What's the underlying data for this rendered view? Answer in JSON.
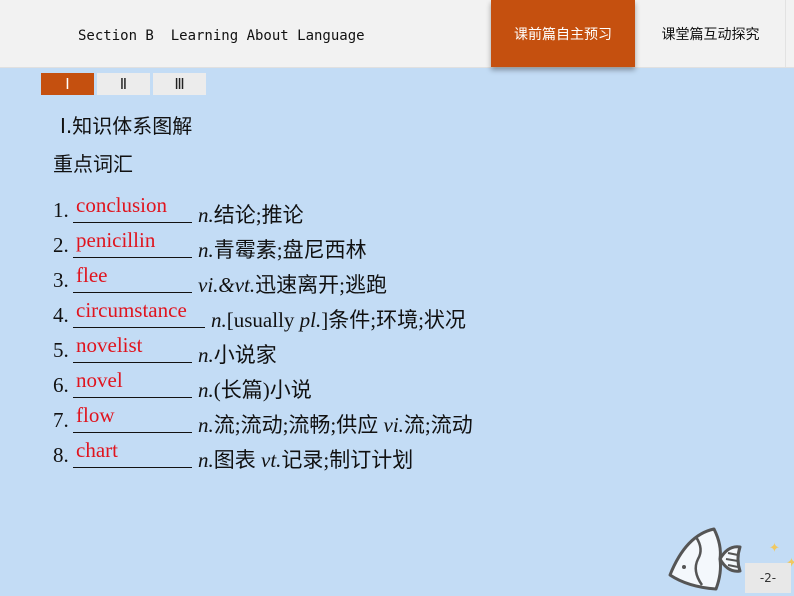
{
  "header": {
    "section_title": "Section B  Learning About Language",
    "nav_tabs": [
      {
        "label": "课前篇自主预习",
        "active": true
      },
      {
        "label": "课堂篇互动探究",
        "active": false
      }
    ]
  },
  "subtabs": [
    {
      "label": "Ⅰ",
      "active": true
    },
    {
      "label": "Ⅱ",
      "active": false
    },
    {
      "label": "Ⅲ",
      "active": false
    }
  ],
  "content": {
    "heading": "Ⅰ.知识体系图解",
    "subheading": "重点词汇",
    "vocab": [
      {
        "num": "1.",
        "answer": "conclusion",
        "pos": "n.",
        "meaning": "结论;推论"
      },
      {
        "num": "2.",
        "answer": "penicillin",
        "pos": "n.",
        "meaning": "青霉素;盘尼西林"
      },
      {
        "num": "3.",
        "answer": "flee",
        "pos": "vi.&vt.",
        "meaning": "迅速离开;逃跑"
      },
      {
        "num": "4.",
        "answer": "circumstance",
        "pos": "n.",
        "meaning_pre": "[usually ",
        "meaning_it": "pl.",
        "meaning": "]条件;环境;状况"
      },
      {
        "num": "5.",
        "answer": "novelist",
        "pos": "n.",
        "meaning": "小说家"
      },
      {
        "num": "6.",
        "answer": "novel",
        "pos": "n.",
        "meaning": "(长篇)小说"
      },
      {
        "num": "7.",
        "answer": "flow",
        "pos": "n.",
        "meaning": "流;流动;流畅;供应 ",
        "pos2": "vi.",
        "meaning2": "流;流动"
      },
      {
        "num": "8.",
        "answer": "chart",
        "pos": "n.",
        "meaning": "图表 ",
        "pos2": "vt.",
        "meaning2": "记录;制订计划"
      }
    ]
  },
  "footer": {
    "page_number": "-2-"
  }
}
